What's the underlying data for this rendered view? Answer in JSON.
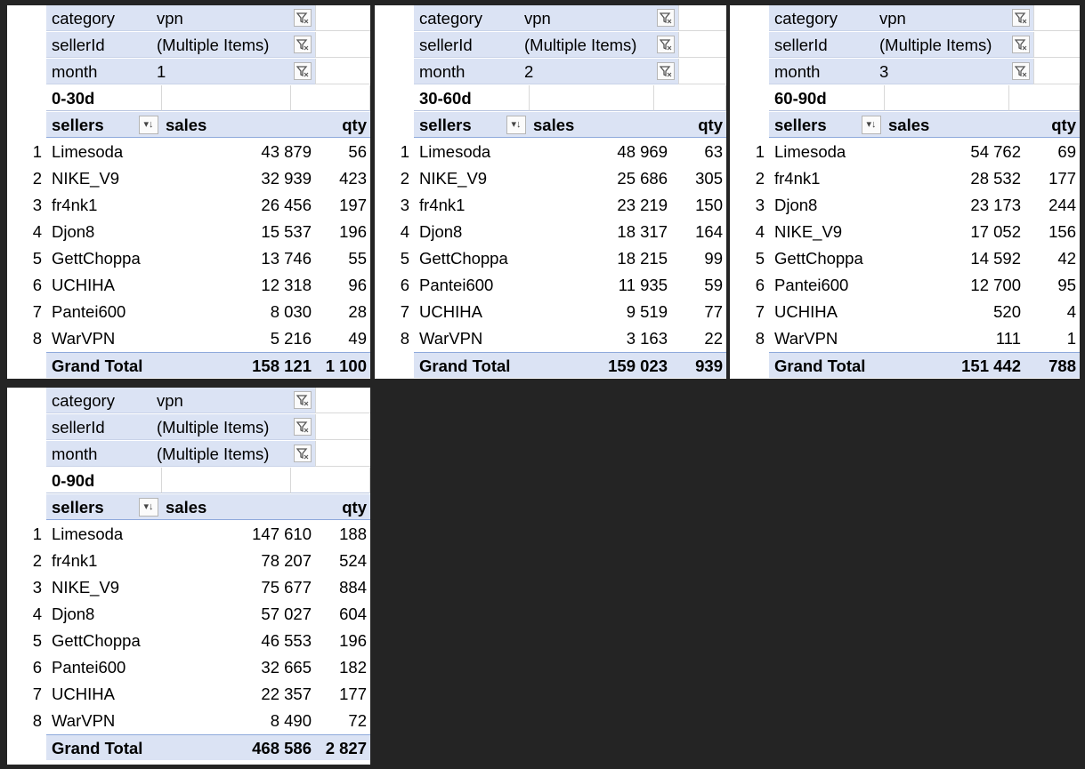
{
  "colors": {
    "background": "#242424",
    "header_fill": "#dbe3f4",
    "header_border": "#8ea9db"
  },
  "icons": {
    "filter": "filter-funnel-icon",
    "sort": "sort-descending-icon"
  },
  "pivots": [
    {
      "filters": [
        {
          "key": "category",
          "value": "vpn"
        },
        {
          "key": "sellerId",
          "value": "(Multiple Items)"
        },
        {
          "key": "month",
          "value": "1"
        }
      ],
      "period": "0-30d",
      "headers": {
        "sellers": "sellers",
        "sales": "sales",
        "qty": "qty"
      },
      "rows": [
        {
          "idx": "1",
          "name": "Limesoda",
          "sales": "43 879",
          "qty": "56"
        },
        {
          "idx": "2",
          "name": "NIKE_V9",
          "sales": "32 939",
          "qty": "423"
        },
        {
          "idx": "3",
          "name": "fr4nk1",
          "sales": "26 456",
          "qty": "197"
        },
        {
          "idx": "4",
          "name": "Djon8",
          "sales": "15 537",
          "qty": "196"
        },
        {
          "idx": "5",
          "name": "GettChoppa",
          "sales": "13 746",
          "qty": "55"
        },
        {
          "idx": "6",
          "name": "UCHIHA",
          "sales": "12 318",
          "qty": "96"
        },
        {
          "idx": "7",
          "name": "Pantei600",
          "sales": "8 030",
          "qty": "28"
        },
        {
          "idx": "8",
          "name": "WarVPN",
          "sales": "5 216",
          "qty": "49"
        }
      ],
      "total": {
        "label": "Grand Total",
        "sales": "158 121",
        "qty": "1 100"
      }
    },
    {
      "filters": [
        {
          "key": "category",
          "value": "vpn"
        },
        {
          "key": "sellerId",
          "value": "(Multiple Items)"
        },
        {
          "key": "month",
          "value": "2"
        }
      ],
      "period": "30-60d",
      "headers": {
        "sellers": "sellers",
        "sales": "sales",
        "qty": "qty"
      },
      "rows": [
        {
          "idx": "1",
          "name": "Limesoda",
          "sales": "48 969",
          "qty": "63"
        },
        {
          "idx": "2",
          "name": "NIKE_V9",
          "sales": "25 686",
          "qty": "305"
        },
        {
          "idx": "3",
          "name": "fr4nk1",
          "sales": "23 219",
          "qty": "150"
        },
        {
          "idx": "4",
          "name": "Djon8",
          "sales": "18 317",
          "qty": "164"
        },
        {
          "idx": "5",
          "name": "GettChoppa",
          "sales": "18 215",
          "qty": "99"
        },
        {
          "idx": "6",
          "name": "Pantei600",
          "sales": "11 935",
          "qty": "59"
        },
        {
          "idx": "7",
          "name": "UCHIHA",
          "sales": "9 519",
          "qty": "77"
        },
        {
          "idx": "8",
          "name": "WarVPN",
          "sales": "3 163",
          "qty": "22"
        }
      ],
      "total": {
        "label": "Grand Total",
        "sales": "159 023",
        "qty": "939"
      }
    },
    {
      "filters": [
        {
          "key": "category",
          "value": "vpn"
        },
        {
          "key": "sellerId",
          "value": "(Multiple Items)"
        },
        {
          "key": "month",
          "value": "3"
        }
      ],
      "period": "60-90d",
      "headers": {
        "sellers": "sellers",
        "sales": "sales",
        "qty": "qty"
      },
      "rows": [
        {
          "idx": "1",
          "name": "Limesoda",
          "sales": "54 762",
          "qty": "69"
        },
        {
          "idx": "2",
          "name": "fr4nk1",
          "sales": "28 532",
          "qty": "177"
        },
        {
          "idx": "3",
          "name": "Djon8",
          "sales": "23 173",
          "qty": "244"
        },
        {
          "idx": "4",
          "name": "NIKE_V9",
          "sales": "17 052",
          "qty": "156"
        },
        {
          "idx": "5",
          "name": "GettChoppa",
          "sales": "14 592",
          "qty": "42"
        },
        {
          "idx": "6",
          "name": "Pantei600",
          "sales": "12 700",
          "qty": "95"
        },
        {
          "idx": "7",
          "name": "UCHIHA",
          "sales": "520",
          "qty": "4"
        },
        {
          "idx": "8",
          "name": "WarVPN",
          "sales": "111",
          "qty": "1"
        }
      ],
      "total": {
        "label": "Grand Total",
        "sales": "151 442",
        "qty": "788"
      }
    },
    {
      "filters": [
        {
          "key": "category",
          "value": "vpn"
        },
        {
          "key": "sellerId",
          "value": "(Multiple Items)"
        },
        {
          "key": "month",
          "value": "(Multiple Items)"
        }
      ],
      "period": "0-90d",
      "headers": {
        "sellers": "sellers",
        "sales": "sales",
        "qty": "qty"
      },
      "rows": [
        {
          "idx": "1",
          "name": "Limesoda",
          "sales": "147 610",
          "qty": "188"
        },
        {
          "idx": "2",
          "name": "fr4nk1",
          "sales": "78 207",
          "qty": "524"
        },
        {
          "idx": "3",
          "name": "NIKE_V9",
          "sales": "75 677",
          "qty": "884"
        },
        {
          "idx": "4",
          "name": "Djon8",
          "sales": "57 027",
          "qty": "604"
        },
        {
          "idx": "5",
          "name": "GettChoppa",
          "sales": "46 553",
          "qty": "196"
        },
        {
          "idx": "6",
          "name": "Pantei600",
          "sales": "32 665",
          "qty": "182"
        },
        {
          "idx": "7",
          "name": "UCHIHA",
          "sales": "22 357",
          "qty": "177"
        },
        {
          "idx": "8",
          "name": "WarVPN",
          "sales": "8 490",
          "qty": "72"
        }
      ],
      "total": {
        "label": "Grand Total",
        "sales": "468 586",
        "qty": "2 827"
      }
    }
  ]
}
